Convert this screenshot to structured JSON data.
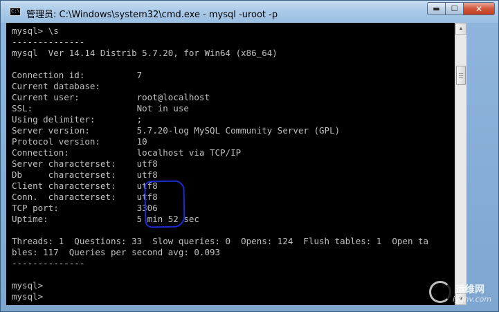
{
  "window": {
    "title": "管理员: C:\\Windows\\system32\\cmd.exe - mysql  -uroot -p",
    "minimize_glyph": "▬",
    "maximize_glyph": "☐",
    "close_glyph": "✕"
  },
  "console": {
    "lines": [
      "mysql> \\s",
      "--------------",
      "mysql  Ver 14.14 Distrib 5.7.20, for Win64 (x86_64)",
      "",
      "Connection id:          7",
      "Current database:",
      "Current user:           root@localhost",
      "SSL:                    Not in use",
      "Using delimiter:        ;",
      "Server version:         5.7.20-log MySQL Community Server (GPL)",
      "Protocol version:       10",
      "Connection:             localhost via TCP/IP",
      "Server characterset:    utf8",
      "Db     characterset:    utf8",
      "Client characterset:    utf8",
      "Conn.  characterset:    utf8",
      "TCP port:               3306",
      "Uptime:                 5 min 52 sec",
      "",
      "Threads: 1  Questions: 33  Slow queries: 0  Opens: 124  Flush tables: 1  Open ta",
      "bles: 117  Queries per second avg: 0.093",
      "--------------",
      "",
      "mysql>",
      "mysql>"
    ]
  },
  "watermark": {
    "text": "运维网",
    "sub": "iyunv.com"
  }
}
